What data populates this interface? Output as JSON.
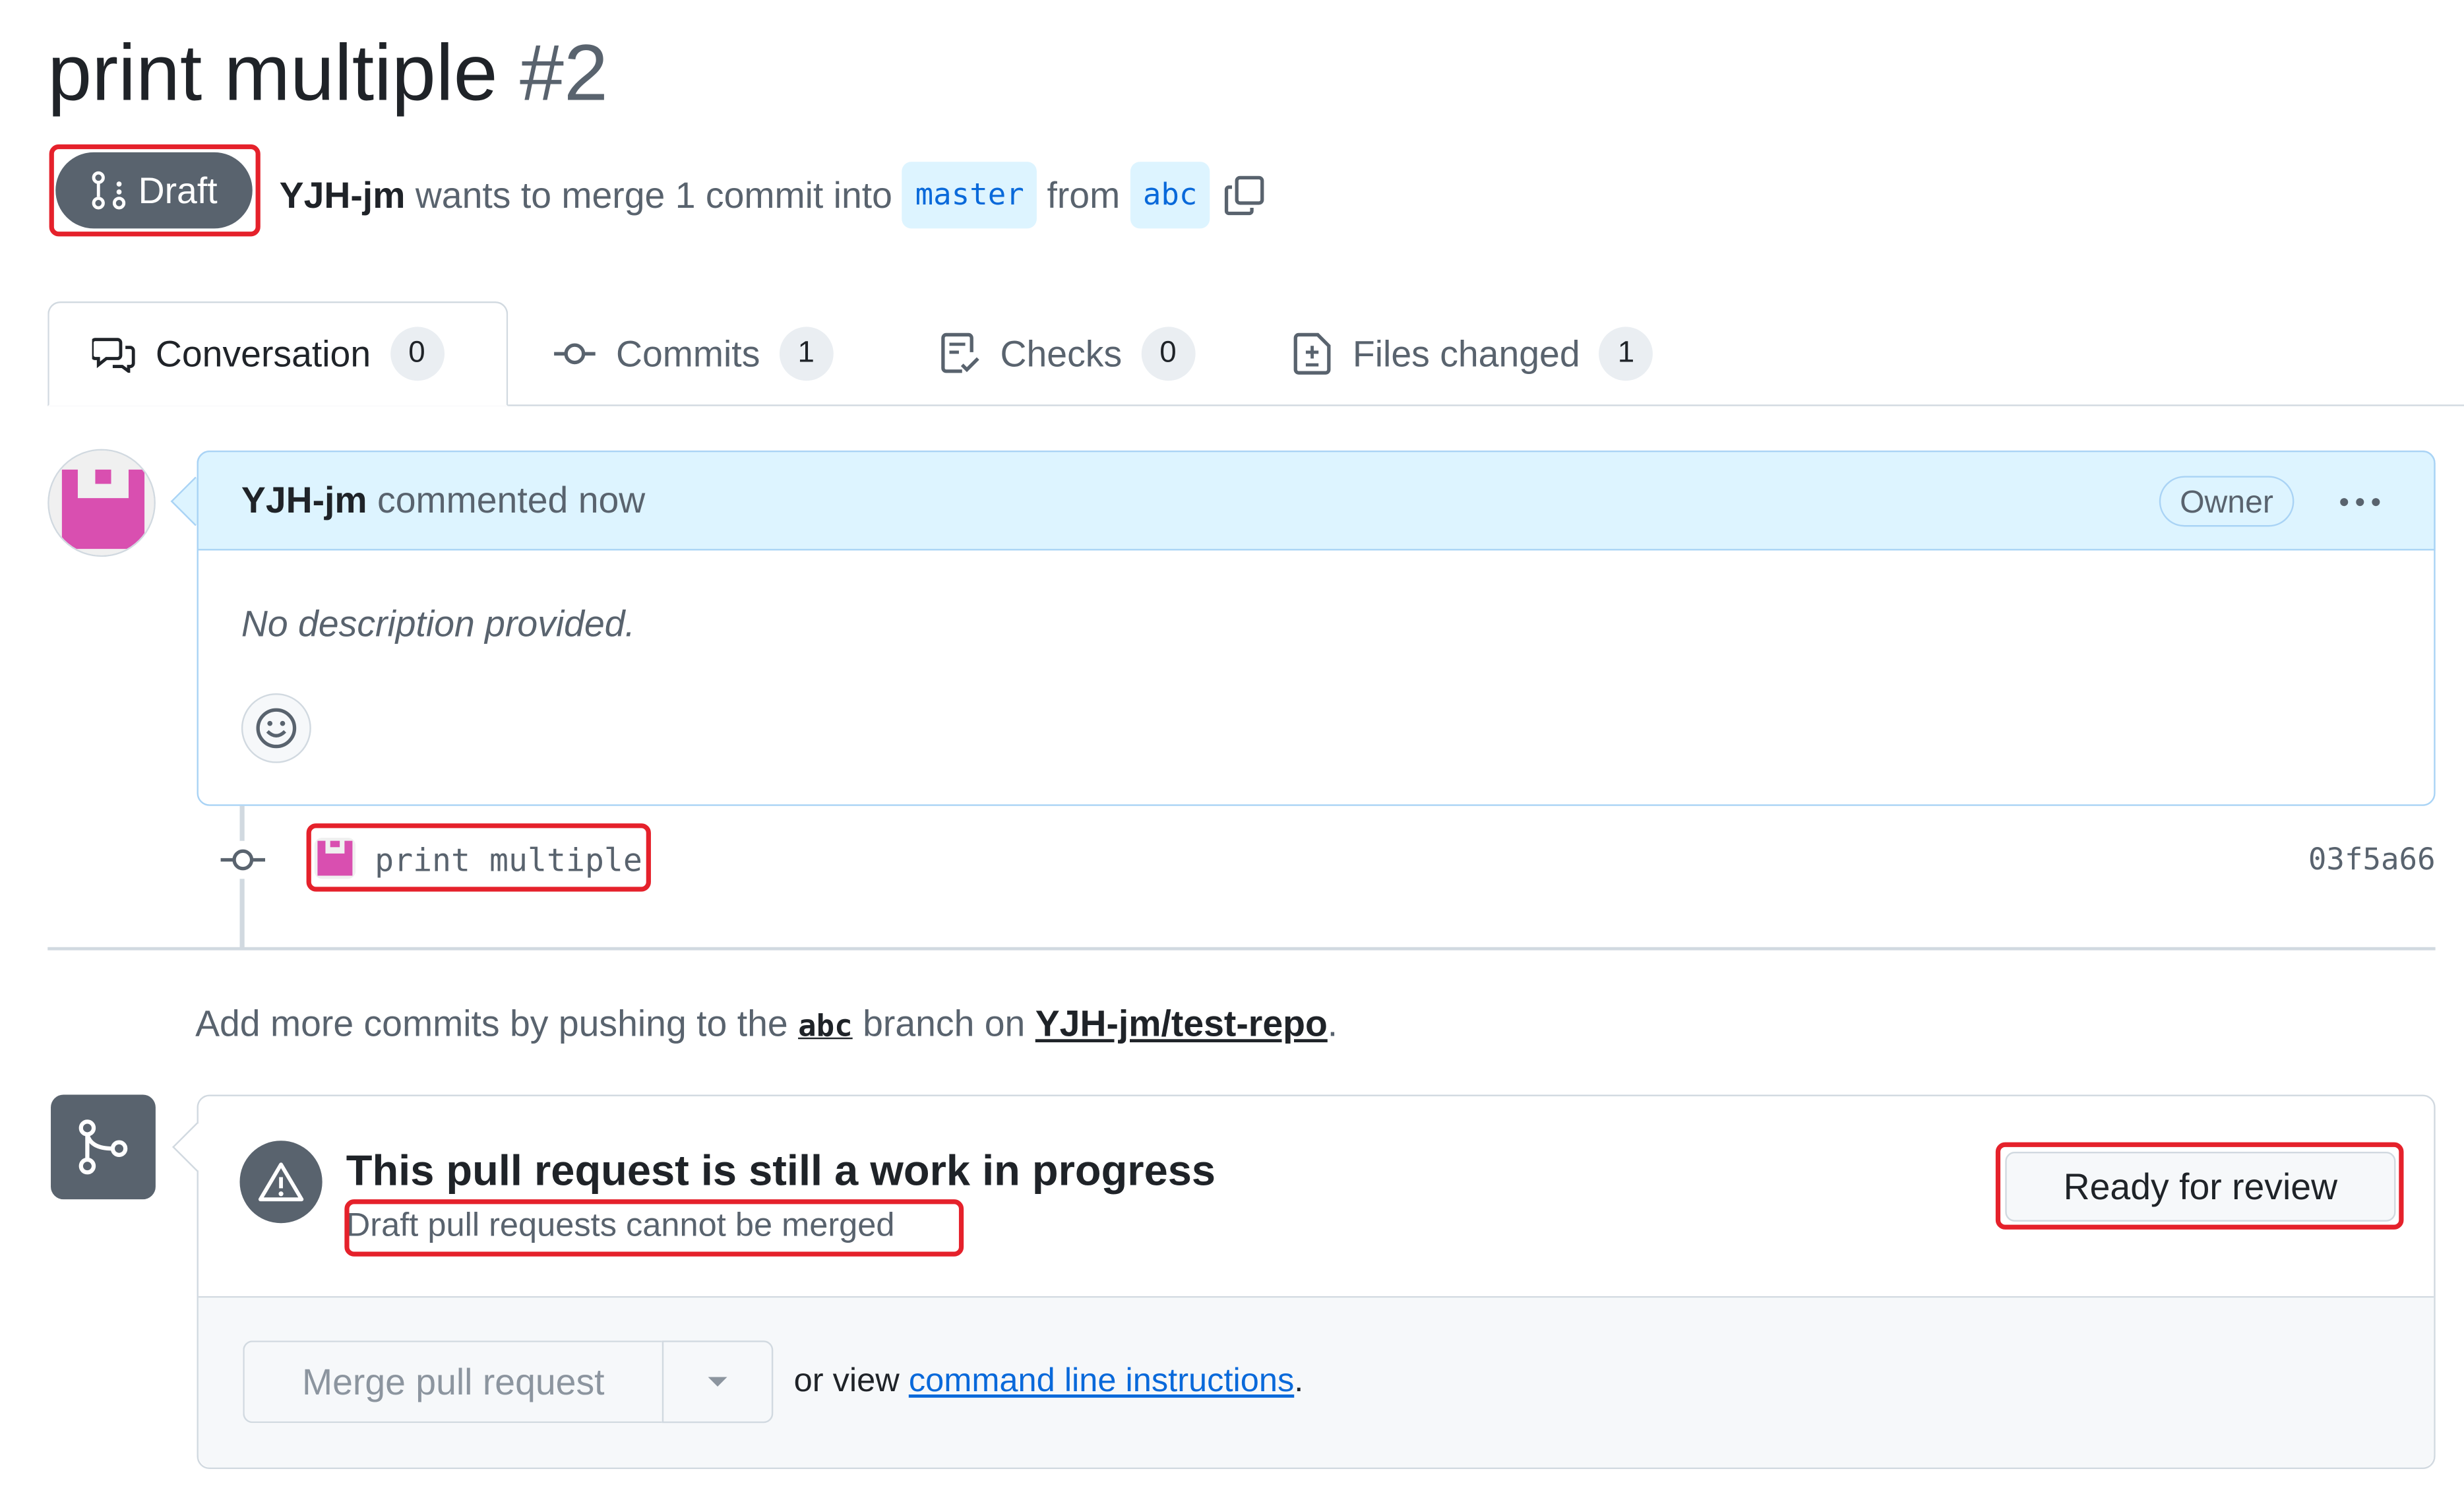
{
  "pr": {
    "title": "print multiple",
    "number": "#2",
    "state_badge": "Draft",
    "author": "YJH-jm",
    "merge_text_a": "wants to merge 1 commit into",
    "base_branch": "master",
    "merge_text_b": "from",
    "head_branch": "abc"
  },
  "tabs": [
    {
      "label": "Conversation",
      "count": "0",
      "icon": "comment-discussion-icon"
    },
    {
      "label": "Commits",
      "count": "1",
      "icon": "git-commit-icon"
    },
    {
      "label": "Checks",
      "count": "0",
      "icon": "checklist-icon"
    },
    {
      "label": "Files changed",
      "count": "1",
      "icon": "file-diff-icon"
    }
  ],
  "comment": {
    "author": "YJH-jm",
    "action": "commented now",
    "role_badge": "Owner",
    "body": "No description provided."
  },
  "commit": {
    "message": "print multiple",
    "sha": "03f5a66"
  },
  "push_info": {
    "text_a": "Add more commits by pushing to the",
    "branch": "abc",
    "text_b": "branch on",
    "repo": "YJH-jm/test-repo",
    "text_c": "."
  },
  "merge": {
    "title": "This pull request is still a work in progress",
    "subtitle": "Draft pull requests cannot be merged",
    "ready_button": "Ready for review",
    "merge_button": "Merge pull request",
    "cli_prefix": "or view",
    "cli_link": "command line instructions",
    "cli_suffix": "."
  },
  "colors": {
    "accent": "#0969da",
    "draft_badge": "#59636e",
    "comment_header": "#ddf4ff",
    "highlight_box": "#e5212b",
    "avatar": "#d94fb0"
  }
}
